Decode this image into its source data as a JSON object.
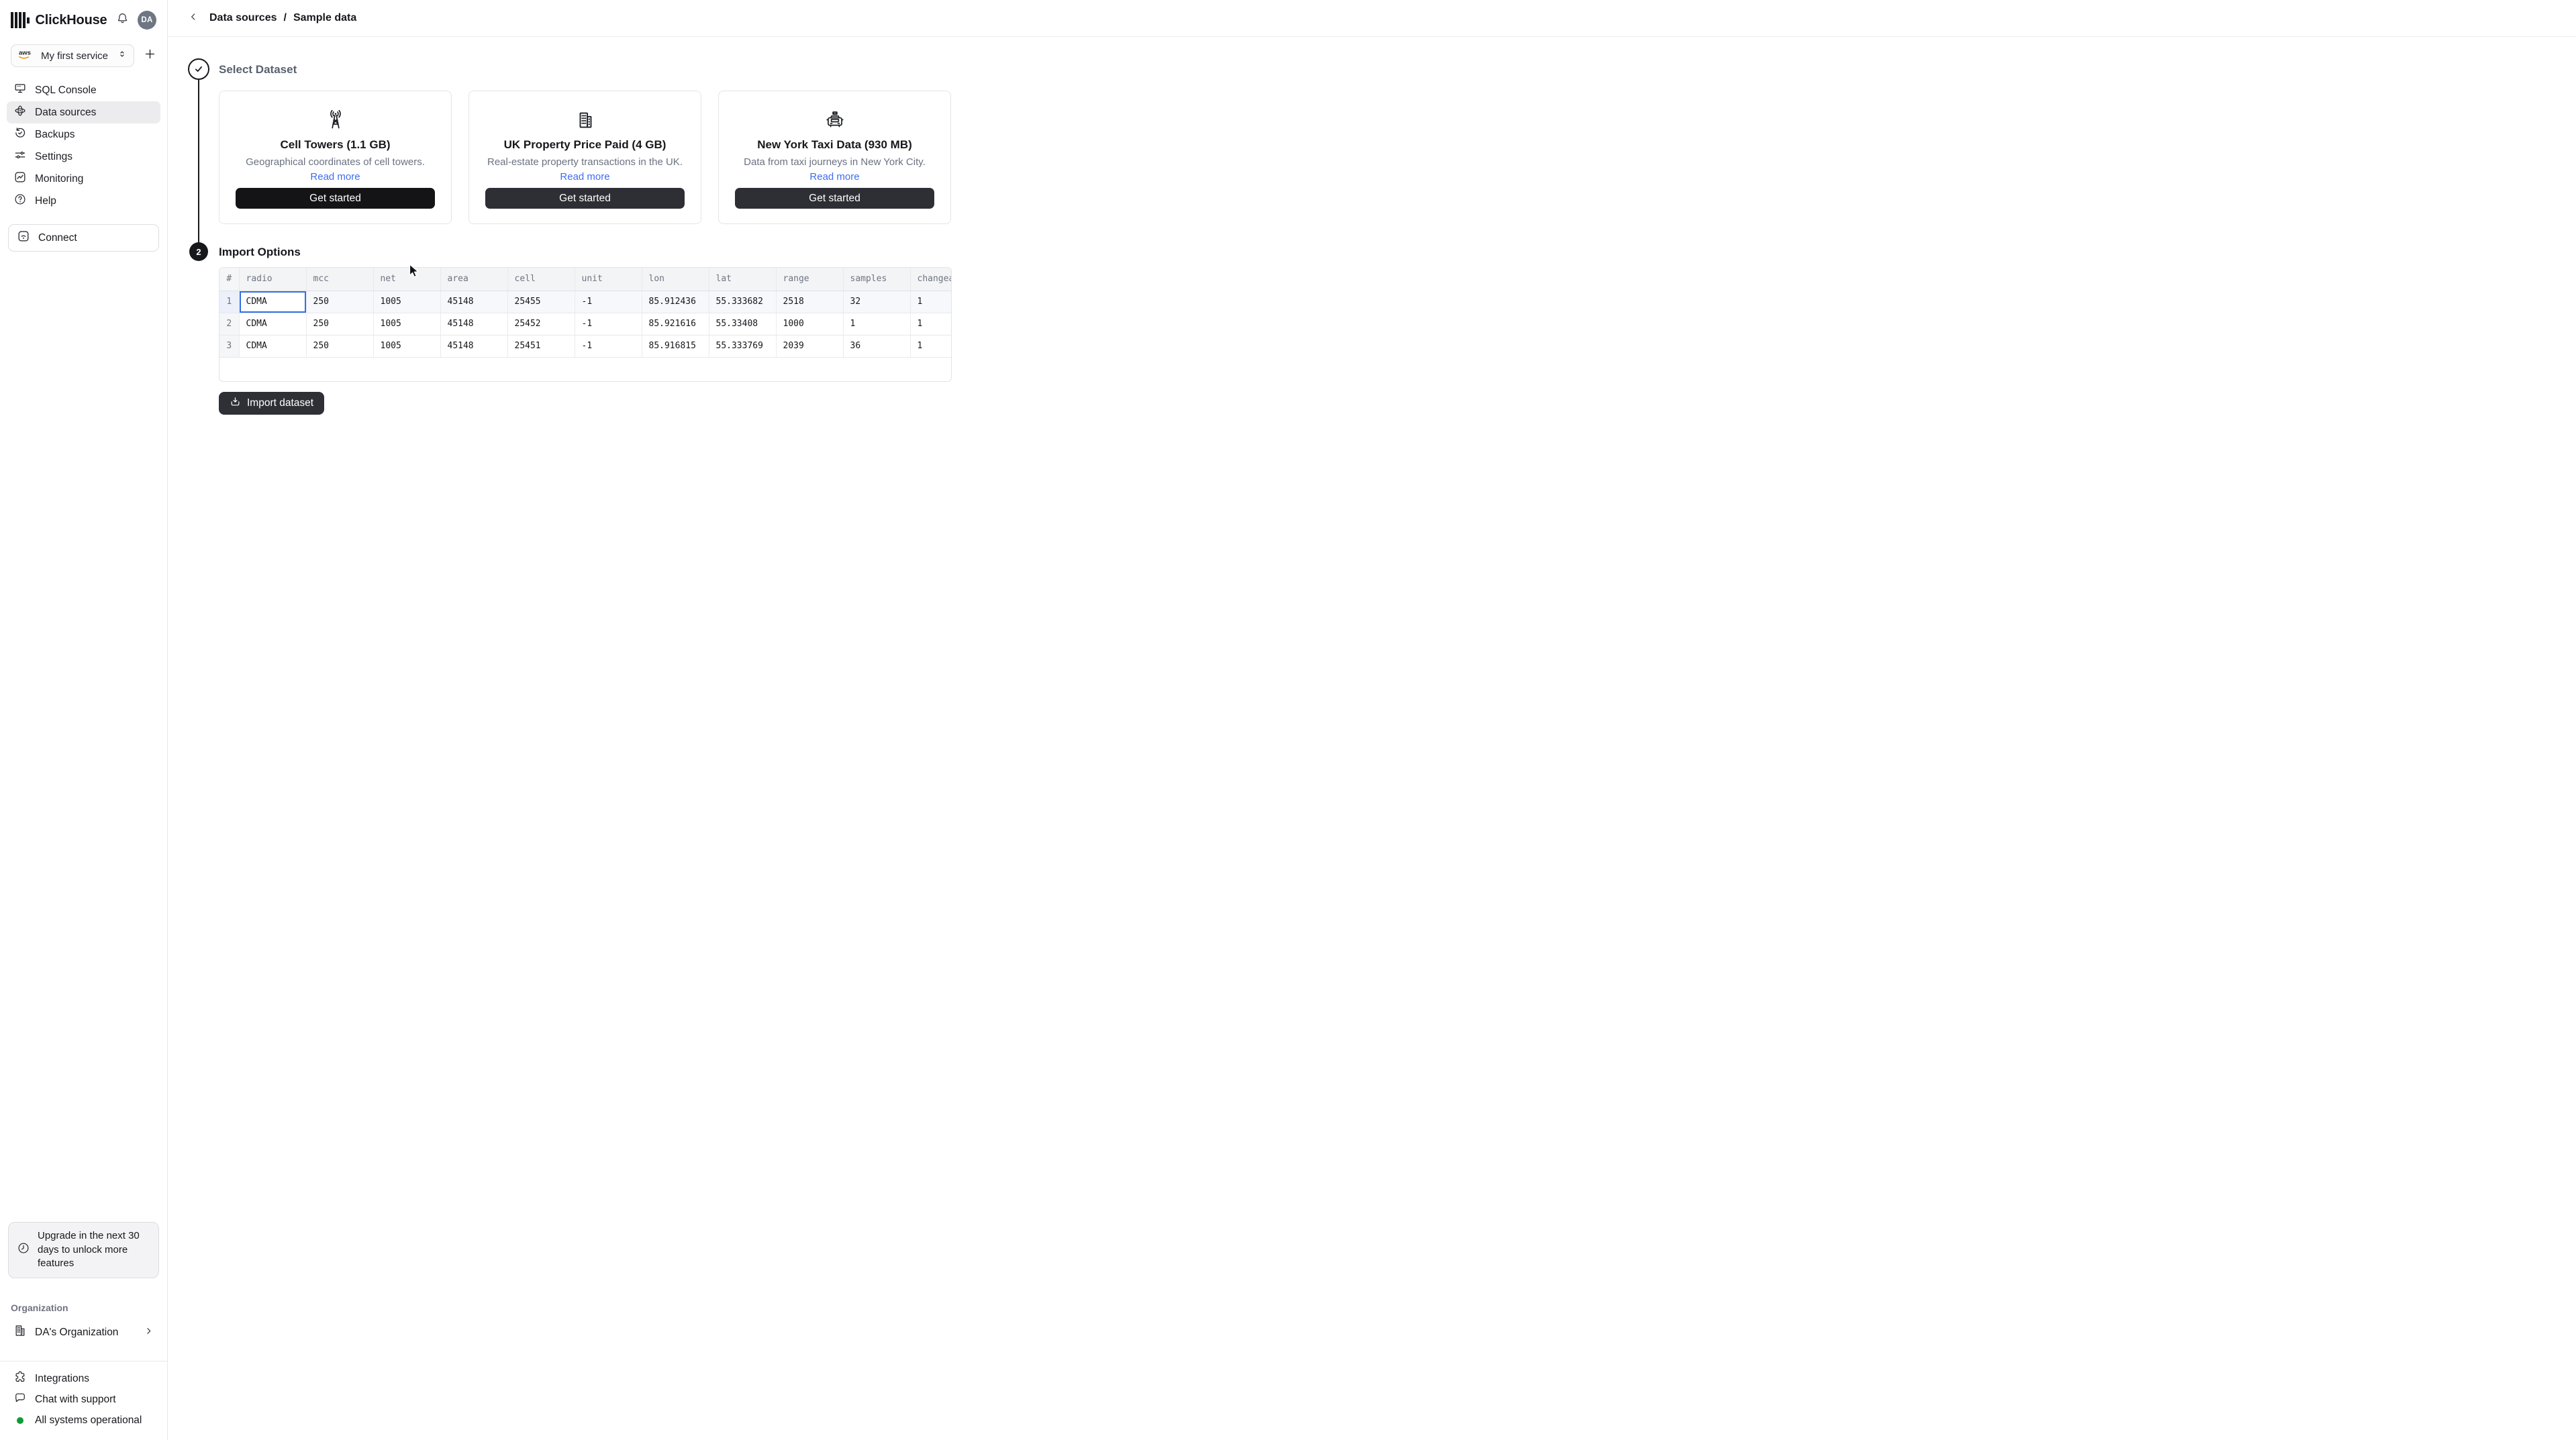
{
  "app": {
    "name": "ClickHouse",
    "avatar": "DA"
  },
  "service": {
    "provider": "aws",
    "label": "My first service"
  },
  "sidebar": {
    "nav": [
      {
        "label": "SQL Console"
      },
      {
        "label": "Data sources"
      },
      {
        "label": "Backups"
      },
      {
        "label": "Settings"
      },
      {
        "label": "Monitoring"
      },
      {
        "label": "Help"
      }
    ],
    "connect_label": "Connect",
    "upgrade_text": "Upgrade in the next 30 days to unlock more features",
    "org_section": "Organization",
    "org_name": "DA's Organization",
    "footer": {
      "integrations": "Integrations",
      "chat": "Chat with support",
      "status": "All systems operational"
    }
  },
  "breadcrumb": {
    "parent": "Data sources",
    "separator": "/",
    "current": "Sample data"
  },
  "steps": {
    "one_title": "Select Dataset",
    "two_number": "2",
    "two_title": "Import Options"
  },
  "datasets": [
    {
      "title": "Cell Towers (1.1 GB)",
      "desc": "Geographical coordinates of cell towers.",
      "link": "Read more",
      "cta": "Get started"
    },
    {
      "title": "UK Property Price Paid (4 GB)",
      "desc": "Real-estate property transactions in the UK.",
      "link": "Read more",
      "cta": "Get started"
    },
    {
      "title": "New York Taxi Data (930 MB)",
      "desc": "Data from taxi journeys in New York City.",
      "link": "Read more",
      "cta": "Get started"
    }
  ],
  "table": {
    "columns": [
      "#",
      "radio",
      "mcc",
      "net",
      "area",
      "cell",
      "unit",
      "lon",
      "lat",
      "range",
      "samples",
      "changeab"
    ],
    "rows": [
      [
        "1",
        "CDMA",
        "250",
        "1005",
        "45148",
        "25455",
        "-1",
        "85.912436",
        "55.333682",
        "2518",
        "32",
        "1"
      ],
      [
        "2",
        "CDMA",
        "250",
        "1005",
        "45148",
        "25452",
        "-1",
        "85.921616",
        "55.33408",
        "1000",
        "1",
        "1"
      ],
      [
        "3",
        "CDMA",
        "250",
        "1005",
        "45148",
        "25451",
        "-1",
        "85.916815",
        "55.333769",
        "2039",
        "36",
        "1"
      ]
    ]
  },
  "import_label": "Import dataset",
  "colors": {
    "accent_blue": "#3e6cf0",
    "selection_border": "#336fe4",
    "primary_button": "#141417",
    "secondary_button": "#2e2f34",
    "status_green": "#109b33",
    "aws_orange": "#f29100"
  },
  "icons": {
    "logo": "clickhouse-bars",
    "bell": "bell",
    "aws": "aws-smile",
    "service_caret": "chevron-up-down",
    "add": "plus",
    "sql_console": "monitor",
    "data_sources": "orbit",
    "backups": "history-check",
    "settings": "sliders",
    "monitoring": "line-chart",
    "help": "question-circle",
    "connect": "wifi-box",
    "upgrade": "clock",
    "organization": "building",
    "org_chevron": "chevron-right",
    "back": "chevron-left",
    "step_done": "check",
    "cell_towers": "radio-tower",
    "uk_property": "building",
    "ny_taxi": "taxi",
    "import": "download-tray",
    "integrations": "puzzle",
    "chat": "speech-bubble",
    "status": "green-dot",
    "cursor": "mouse-pointer"
  }
}
